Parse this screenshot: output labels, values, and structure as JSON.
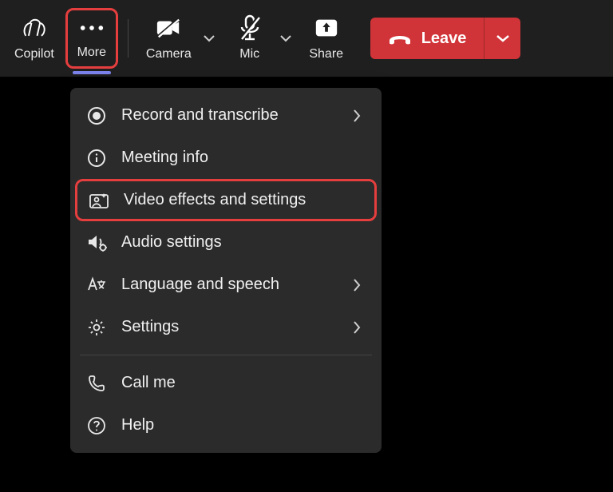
{
  "toolbar": {
    "copilot_label": "Copilot",
    "more_label": "More",
    "camera_label": "Camera",
    "mic_label": "Mic",
    "share_label": "Share",
    "leave_label": "Leave"
  },
  "menu": {
    "record": "Record and transcribe",
    "meeting_info": "Meeting info",
    "video_effects": "Video effects and settings",
    "audio_settings": "Audio settings",
    "language": "Language and speech",
    "settings": "Settings",
    "call_me": "Call me",
    "help": "Help"
  },
  "colors": {
    "highlight": "#e53e3e",
    "accent": "#7b83eb",
    "leave": "#d13438"
  }
}
